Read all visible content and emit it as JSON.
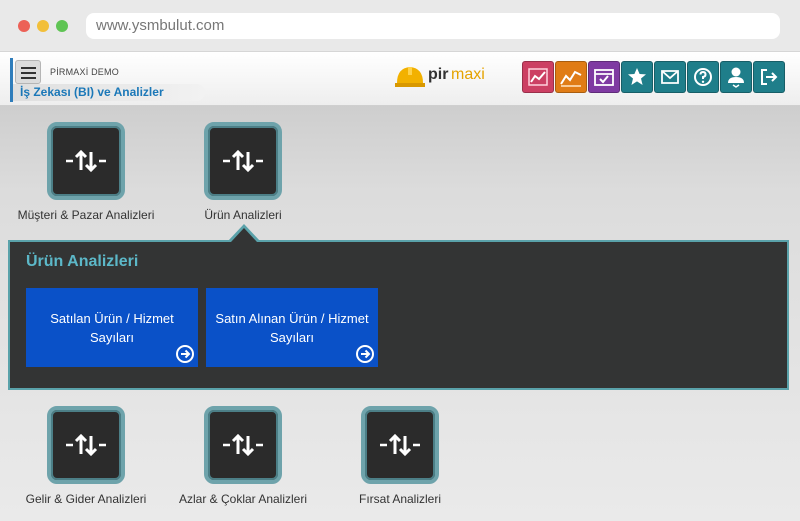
{
  "browser": {
    "url": "www.ysmbulut.com"
  },
  "header": {
    "company": "PİRMAXİ DEMO",
    "module": "İş Zekası (BI) ve Analizler",
    "logo_pir": "pir",
    "logo_maxi": "maxi"
  },
  "toolbar": {
    "icons": [
      "chart-icon",
      "trend-icon",
      "calendar-check-icon",
      "star-icon",
      "mail-icon",
      "help-icon",
      "user-icon",
      "logout-icon"
    ]
  },
  "tiles_top": [
    {
      "label": "Müşteri & Pazar Analizleri",
      "icon": "exchange-arrows-icon"
    },
    {
      "label": "Ürün Analizleri",
      "icon": "exchange-arrows-icon"
    }
  ],
  "panel": {
    "title": "Ürün Analizleri",
    "cards": [
      {
        "label": "Satılan Ürün / Hizmet Sayıları",
        "icon": "arrow-right-circle-icon"
      },
      {
        "label": "Satın Alınan Ürün / Hizmet Sayıları",
        "icon": "arrow-right-circle-icon"
      }
    ]
  },
  "tiles_bottom": [
    {
      "label": "Gelir & Gider Analizleri",
      "icon": "exchange-arrows-icon"
    },
    {
      "label": "Azlar & Çoklar Analizleri",
      "icon": "exchange-arrows-icon"
    },
    {
      "label": "Fırsat Analizleri",
      "icon": "exchange-arrows-icon"
    }
  ],
  "colors": {
    "accent": "#1b78b8",
    "panel_bg": "#333434",
    "panel_border": "#5aa2aa",
    "card_bg": "#0a51c8",
    "panel_title": "#5cb8c8"
  }
}
